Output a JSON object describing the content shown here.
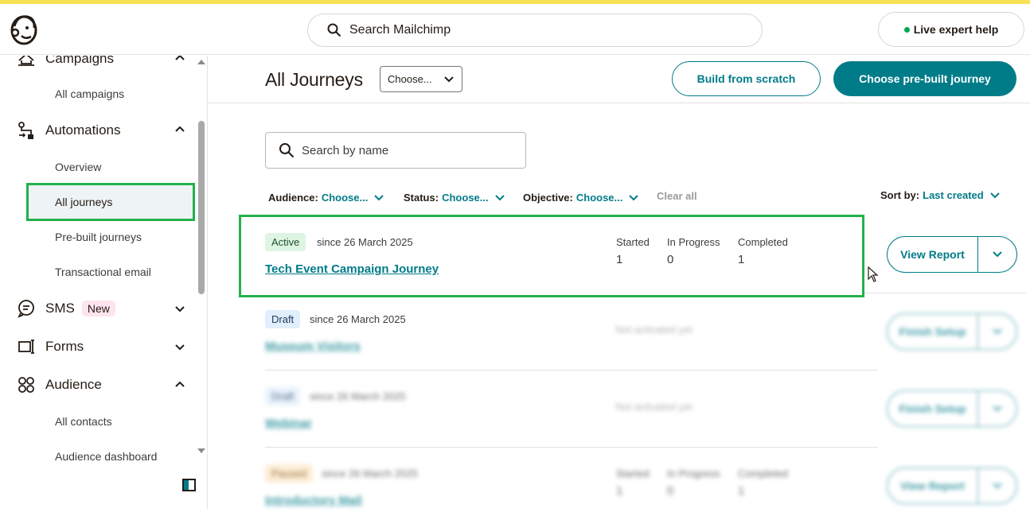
{
  "topbar": {
    "logo_icon": "mailchimp-freddie-icon",
    "search_placeholder": "Search Mailchimp",
    "live_help_label": "Live expert help",
    "accent_color": "#f7e154"
  },
  "sidebar": {
    "sections": [
      {
        "label": "Campaigns",
        "icon": "campaigns-icon",
        "expanded": true
      },
      {
        "label": "Automations",
        "icon": "automations-icon",
        "expanded": true
      },
      {
        "label": "SMS",
        "icon": "sms-icon",
        "badge": "New",
        "expanded": false
      },
      {
        "label": "Forms",
        "icon": "forms-icon",
        "expanded": false
      },
      {
        "label": "Audience",
        "icon": "audience-icon",
        "expanded": true
      }
    ],
    "sub_items": {
      "all_campaigns": "All campaigns",
      "overview": "Overview",
      "all_journeys": "All journeys",
      "prebuilt_journeys": "Pre-built journeys",
      "transactional_email": "Transactional email",
      "all_contacts": "All contacts",
      "audience_dashboard": "Audience dashboard"
    }
  },
  "main": {
    "title": "All Journeys",
    "choose_select": "Choose...",
    "build_from_scratch": "Build from scratch",
    "choose_prebuilt": "Choose pre-built journey",
    "search_placeholder": "Search by name",
    "filters": {
      "audience_label": "Audience:",
      "audience_value": "Choose...",
      "status_label": "Status:",
      "status_value": "Choose...",
      "objective_label": "Objective:",
      "objective_value": "Choose...",
      "clear_all": "Clear all",
      "sort_label": "Sort by:",
      "sort_value": "Last created"
    },
    "journeys": [
      {
        "status": "Active",
        "since": "since 26 March 2025",
        "name": "Tech Event Campaign Journey",
        "started_label": "Started",
        "started": "1",
        "in_progress_label": "In Progress",
        "in_progress": "0",
        "completed_label": "Completed",
        "completed": "1",
        "action": "View Report"
      },
      {
        "status": "Draft",
        "since": "since 26 March 2025",
        "name": "Museum Visitors",
        "not_activated": "Not activated yet",
        "action": "Finish Setup"
      },
      {
        "status": "Draft",
        "since": "since 26 March 2025",
        "name": "Webinar",
        "not_activated": "Not activated yet",
        "action": "Finish Setup"
      },
      {
        "status": "Paused",
        "since": "since 26 March 2025",
        "name": "Introductory Mail",
        "started_label": "Started",
        "started": "1",
        "in_progress_label": "In Progress",
        "in_progress": "0",
        "completed_label": "Completed",
        "completed": "1",
        "action": "View Report"
      }
    ],
    "colors": {
      "brand": "#007c89",
      "active_badge": "#dff5e3",
      "draft_badge": "#e1eefb",
      "paused_badge": "#fde7c7"
    }
  }
}
